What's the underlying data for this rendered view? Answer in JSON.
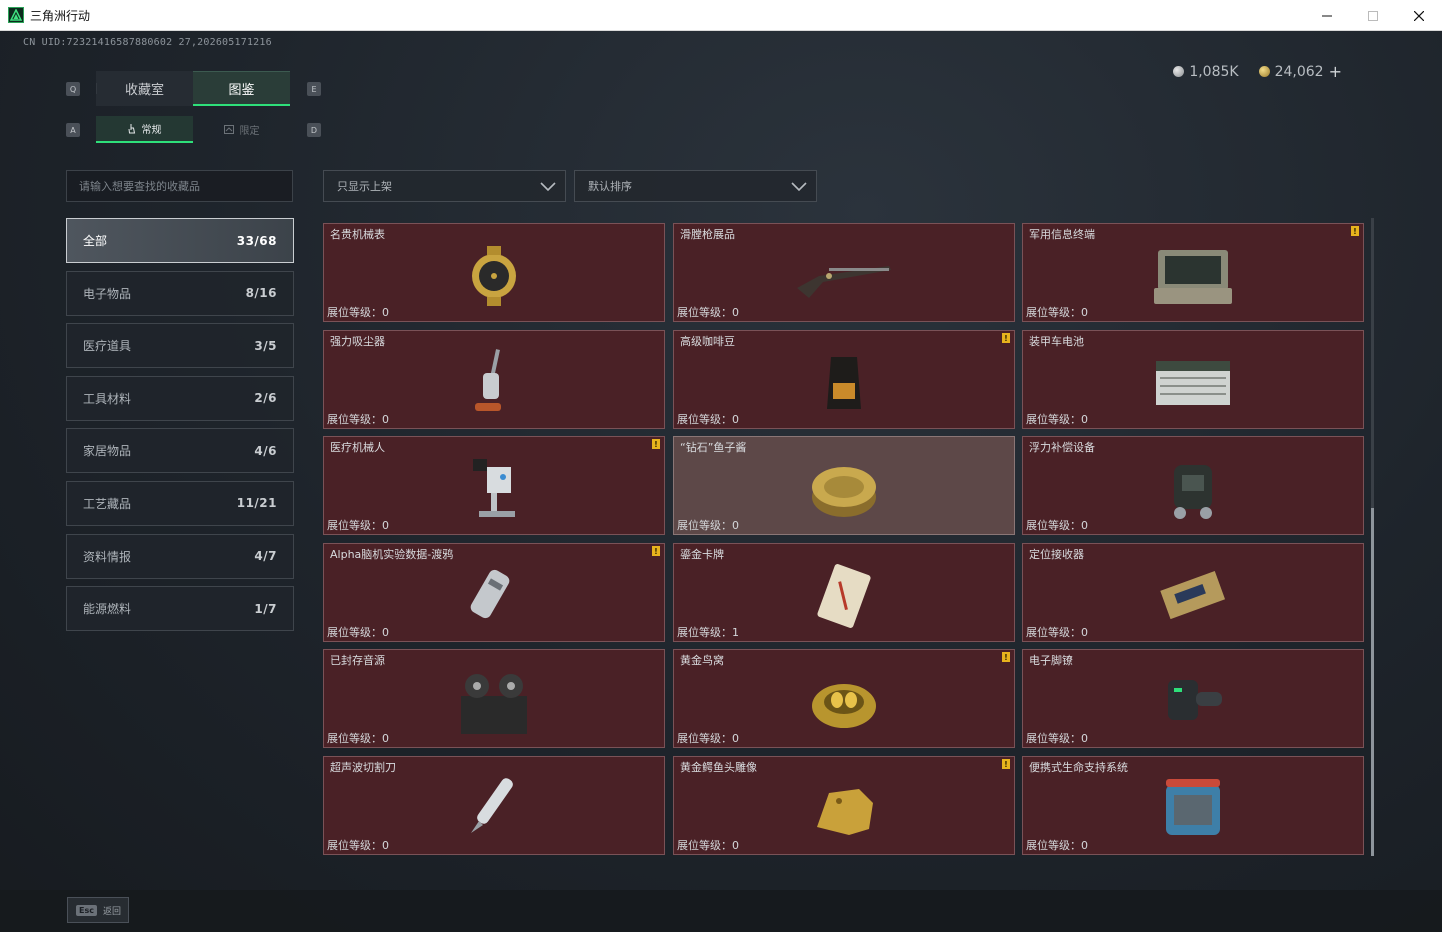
{
  "window": {
    "title": "三角洲行动"
  },
  "uid": "CN UID:72321416587880602 27,202605171216",
  "currency": {
    "silver": "1,085K",
    "gold": "24,062",
    "add": "+"
  },
  "key_hints": {
    "q": "Q",
    "e": "E",
    "a": "A",
    "d": "D"
  },
  "tabs": [
    {
      "label": "收藏室"
    },
    {
      "label": "图鉴"
    }
  ],
  "subtabs": [
    {
      "label": "常规"
    },
    {
      "label": "限定"
    }
  ],
  "search": {
    "placeholder": "请输入想要查找的收藏品"
  },
  "filters": {
    "show": "只显示上架",
    "sort": "默认排序"
  },
  "categories": [
    {
      "label": "全部",
      "count": "33/68"
    },
    {
      "label": "电子物品",
      "count": "8/16"
    },
    {
      "label": "医疗道具",
      "count": "3/5"
    },
    {
      "label": "工具材料",
      "count": "2/6"
    },
    {
      "label": "家居物品",
      "count": "4/6"
    },
    {
      "label": "工艺藏品",
      "count": "11/21"
    },
    {
      "label": "资料情报",
      "count": "4/7"
    },
    {
      "label": "能源燃料",
      "count": "1/7"
    }
  ],
  "level_label": "展位等级：",
  "alert_mark": "!",
  "items": [
    {
      "name": "名贵机械表",
      "level": "0",
      "alert": false,
      "icon": "watch-icon"
    },
    {
      "name": "滑膛枪展品",
      "level": "0",
      "alert": false,
      "icon": "musket-icon"
    },
    {
      "name": "军用信息终端",
      "level": "0",
      "alert": true,
      "icon": "terminal-icon"
    },
    {
      "name": "强力吸尘器",
      "level": "0",
      "alert": false,
      "icon": "vacuum-icon"
    },
    {
      "name": "高级咖啡豆",
      "level": "0",
      "alert": true,
      "icon": "coffee-bag-icon"
    },
    {
      "name": "装甲车电池",
      "level": "0",
      "alert": false,
      "icon": "battery-icon"
    },
    {
      "name": "医疗机械人",
      "level": "0",
      "alert": true,
      "icon": "robot-icon"
    },
    {
      "name": "“钻石”鱼子酱",
      "level": "0",
      "alert": false,
      "icon": "caviar-tin-icon"
    },
    {
      "name": "浮力补偿设备",
      "level": "0",
      "alert": false,
      "icon": "bcd-vest-icon"
    },
    {
      "name": "Alpha脑机实验数据-渡鸦",
      "level": "0",
      "alert": true,
      "icon": "data-canister-icon"
    },
    {
      "name": "鎏金卡牌",
      "level": "1",
      "alert": false,
      "icon": "card-icon"
    },
    {
      "name": "定位接收器",
      "level": "0",
      "alert": false,
      "icon": "receiver-icon"
    },
    {
      "name": "已封存音源",
      "level": "0",
      "alert": false,
      "icon": "tape-recorder-icon"
    },
    {
      "name": "黄金鸟窝",
      "level": "0",
      "alert": true,
      "icon": "golden-nest-icon"
    },
    {
      "name": "电子脚镣",
      "level": "0",
      "alert": false,
      "icon": "ankle-monitor-icon"
    },
    {
      "name": "超声波切割刀",
      "level": "0",
      "alert": false,
      "icon": "cutter-icon"
    },
    {
      "name": "黄金鳄鱼头雕像",
      "level": "0",
      "alert": true,
      "icon": "croc-statue-icon"
    },
    {
      "name": "便携式生命支持系统",
      "level": "0",
      "alert": false,
      "icon": "life-support-icon"
    }
  ],
  "footer": {
    "esc_key": "Esc",
    "back": "返回"
  }
}
